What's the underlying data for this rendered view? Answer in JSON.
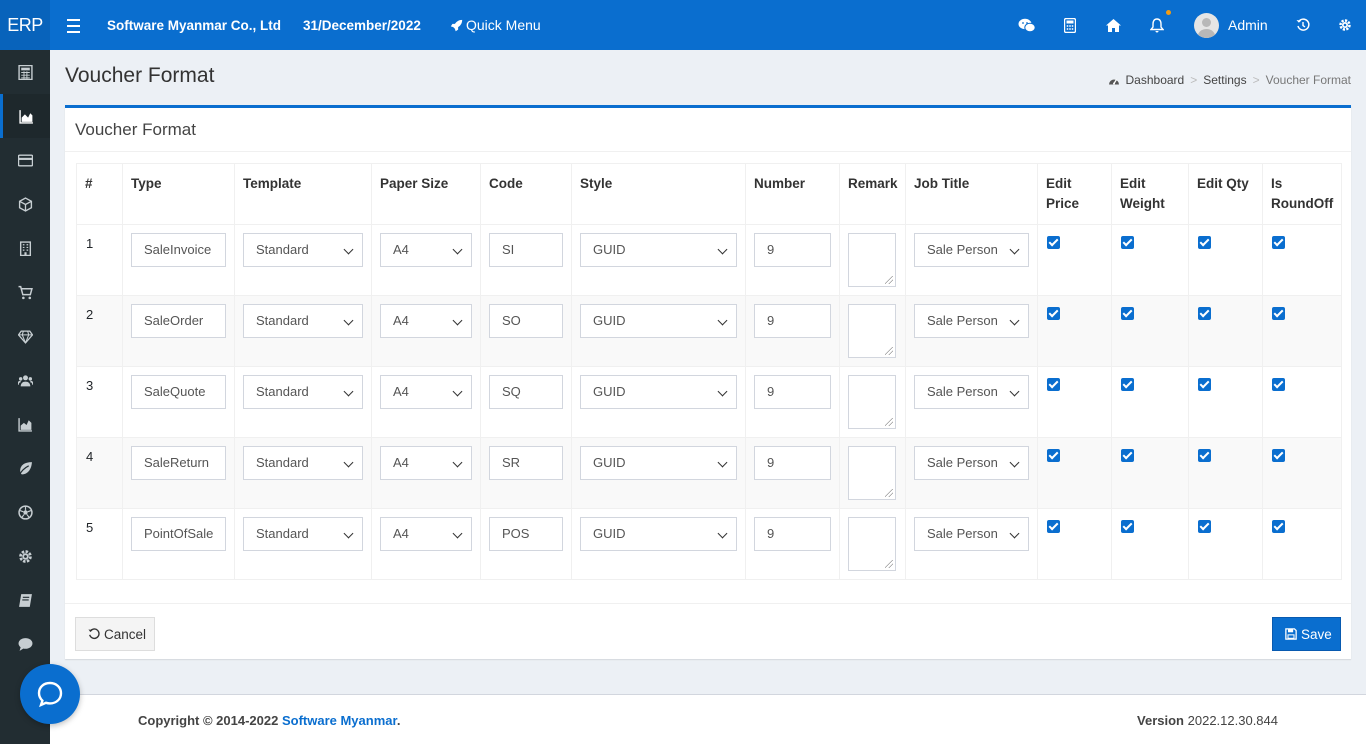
{
  "app": {
    "brand": "ERP",
    "company": "Software Myanmar Co., Ltd",
    "date": "31/December/2022",
    "quick_menu": "Quick Menu",
    "user": "Admin"
  },
  "sidebar": {
    "items": [
      {
        "icon": "calculator-icon"
      },
      {
        "icon": "area-chart-icon",
        "active": true
      },
      {
        "icon": "credit-card-icon"
      },
      {
        "icon": "cube-icon"
      },
      {
        "icon": "building-icon"
      },
      {
        "icon": "shopping-cart-icon"
      },
      {
        "icon": "diamond-icon"
      },
      {
        "icon": "users-icon"
      },
      {
        "icon": "bar-chart-icon"
      },
      {
        "icon": "leaf-icon"
      },
      {
        "icon": "soccer-ball-icon"
      },
      {
        "icon": "gear-icon"
      },
      {
        "icon": "book-icon"
      },
      {
        "icon": "comment-icon"
      }
    ]
  },
  "page": {
    "title": "Voucher Format",
    "breadcrumb": [
      "Dashboard",
      "Settings",
      "Voucher Format"
    ]
  },
  "panel": {
    "title": "Voucher Format"
  },
  "table": {
    "headers": {
      "num": "#",
      "type": "Type",
      "template": "Template",
      "paper": "Paper Size",
      "code": "Code",
      "style": "Style",
      "number": "Number",
      "remark": "Remark",
      "job": "Job Title",
      "edit_price": "Edit\nPrice",
      "edit_weight": "Edit\nWeight",
      "edit_qty": "Edit Qty",
      "roundoff": "Is\nRoundOff"
    },
    "rows": [
      {
        "num": "1",
        "type": "SaleInvoice",
        "template": "Standard",
        "paper": "A4",
        "code": "SI",
        "style": "GUID",
        "number": "9",
        "remark": "",
        "job": "Sale Person"
      },
      {
        "num": "2",
        "type": "SaleOrder",
        "template": "Standard",
        "paper": "A4",
        "code": "SO",
        "style": "GUID",
        "number": "9",
        "remark": "",
        "job": "Sale Person"
      },
      {
        "num": "3",
        "type": "SaleQuote",
        "template": "Standard",
        "paper": "A4",
        "code": "SQ",
        "style": "GUID",
        "number": "9",
        "remark": "",
        "job": "Sale Person"
      },
      {
        "num": "4",
        "type": "SaleReturn",
        "template": "Standard",
        "paper": "A4",
        "code": "SR",
        "style": "GUID",
        "number": "9",
        "remark": "",
        "job": "Sale Person"
      },
      {
        "num": "5",
        "type": "PointOfSale",
        "template": "Standard",
        "paper": "A4",
        "code": "POS",
        "style": "GUID",
        "number": "9",
        "remark": "",
        "job": "Sale Person"
      }
    ]
  },
  "buttons": {
    "cancel": "Cancel",
    "save": "Save"
  },
  "footer": {
    "copyright_prefix": "Copyright © 2014-2022 ",
    "copyright_link": "Software Myanmar",
    "copyright_suffix": ".",
    "version_label": "Version",
    "version_value": "2022.12.30.844"
  },
  "colors": {
    "primary": "#0a6ecf",
    "sidebar": "#222d32",
    "background": "#ecf0f5"
  }
}
